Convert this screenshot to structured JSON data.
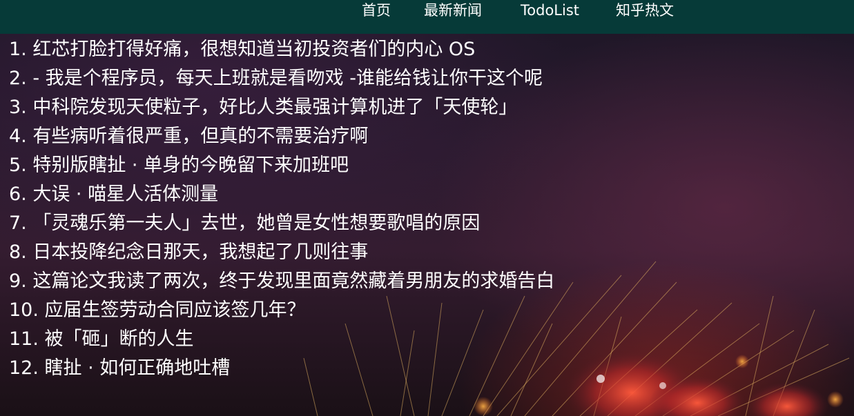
{
  "nav": {
    "home": "首页",
    "news": "最新新闻",
    "todo": "TodoList",
    "zhihu": "知乎热文"
  },
  "articles": [
    "1. 红芯打脸打得好痛，很想知道当初投资者们的内心 OS",
    "2. - 我是个程序员，每天上班就是看吻戏 -谁能给钱让你干这个呢",
    "3. 中科院发现天使粒子，好比人类最强计算机进了「天使轮」",
    "4. 有些病听着很严重，但真的不需要治疗啊",
    "5. 特别版瞎扯 · 单身的今晚留下来加班吧",
    "6. 大误 · 喵星人活体测量",
    "7. 「灵魂乐第一夫人」去世，她曾是女性想要歌唱的原因",
    "8. 日本投降纪念日那天，我想起了几则往事",
    "9. 这篇论文我读了两次，终于发现里面竟然藏着男朋友的求婚告白",
    "10. 应届生签劳动合同应该签几年？",
    "11. 被「砸」断的人生",
    "12. 瞎扯 · 如何正确地吐槽"
  ],
  "colors": {
    "navbar": "#063a38",
    "text": "#ffffff"
  }
}
